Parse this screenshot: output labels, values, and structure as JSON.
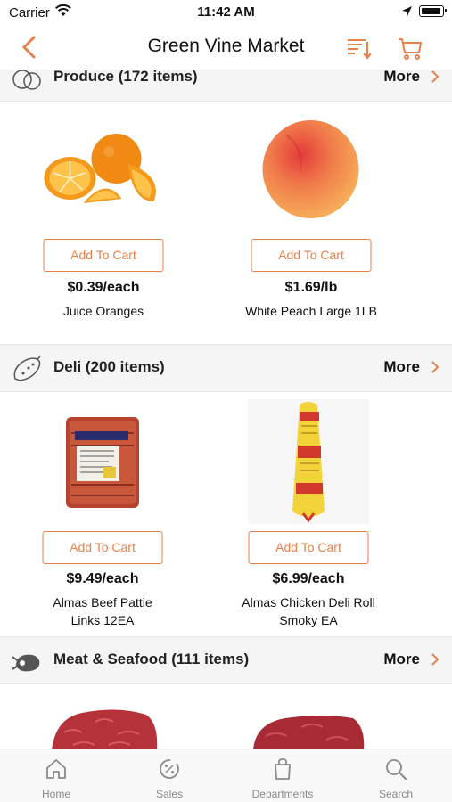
{
  "status_bar": {
    "carrier": "Carrier",
    "time": "11:42 AM"
  },
  "nav": {
    "title": "Green Vine Market"
  },
  "colors": {
    "accent": "#e7814a",
    "section_bg": "#f5f5f5"
  },
  "sections": [
    {
      "title": "Produce (172 items)",
      "more_label": "More",
      "icon": "produce-icon",
      "products": [
        {
          "add_label": "Add To Cart",
          "price": "$0.39/each",
          "name": "Juice Oranges"
        },
        {
          "add_label": "Add To Cart",
          "price": "$1.69/lb",
          "name": "White Peach Large 1LB"
        }
      ]
    },
    {
      "title": "Deli (200 items)",
      "more_label": "More",
      "icon": "salami-icon",
      "products": [
        {
          "add_label": "Add To Cart",
          "price": "$9.49/each",
          "name_line1": "Almas Beef Pattie",
          "name_line2": "Links 12EA"
        },
        {
          "add_label": "Add To Cart",
          "price": "$6.99/each",
          "name_line1": "Almas Chicken Deli Roll",
          "name_line2": "Smoky  EA"
        }
      ]
    },
    {
      "title": "Meat & Seafood (111 items)",
      "more_label": "More",
      "icon": "meat-icon"
    }
  ],
  "tab_bar": {
    "items": [
      {
        "label": "Home",
        "icon": "home-icon"
      },
      {
        "label": "Sales",
        "icon": "sales-icon"
      },
      {
        "label": "Departments",
        "icon": "departments-icon"
      },
      {
        "label": "Search",
        "icon": "search-icon"
      }
    ]
  }
}
